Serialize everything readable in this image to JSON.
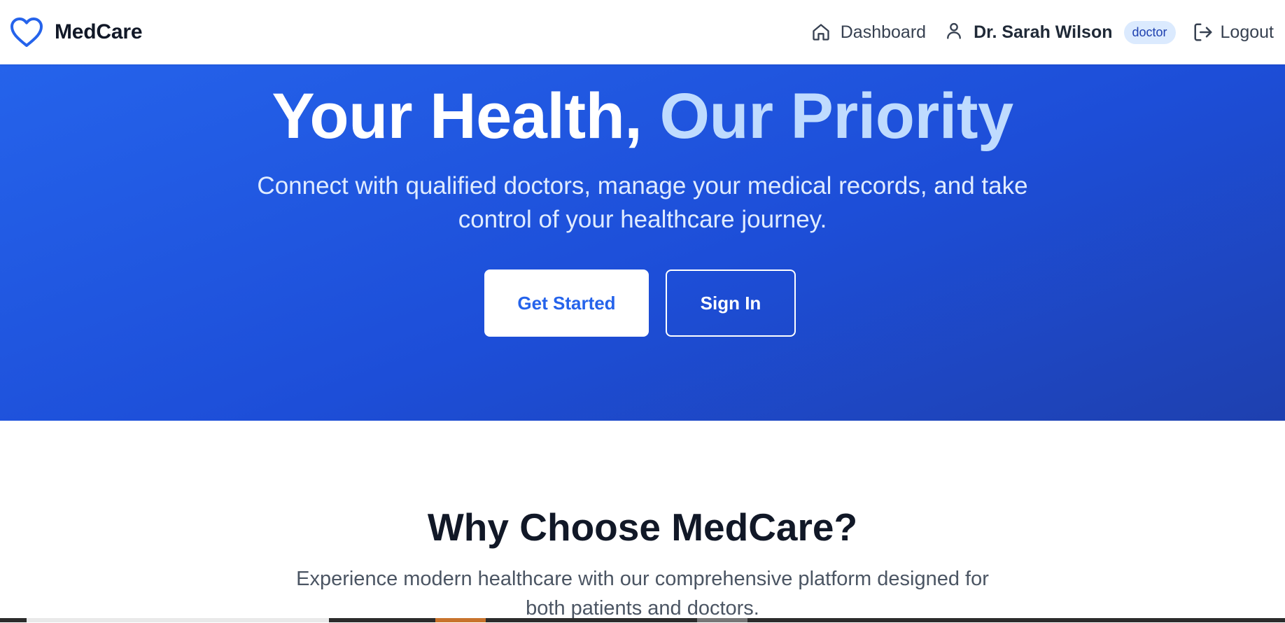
{
  "app": {
    "brand_name": "MedCare",
    "brand_icon": "heart-icon",
    "accent_color": "#2563eb"
  },
  "nav": {
    "dashboard_label": "Dashboard",
    "dashboard_icon": "home-icon",
    "user_icon": "user-icon",
    "user_name": "Dr. Sarah Wilson",
    "user_role": "doctor",
    "logout_label": "Logout",
    "logout_icon": "logout-icon"
  },
  "hero": {
    "title_part1": "Your Health, ",
    "title_part2": "Our Priority",
    "subtitle": "Connect with qualified doctors, manage your medical records, and take control of your healthcare journey.",
    "primary_button": "Get Started",
    "secondary_button": "Sign In",
    "background_color": "#1d4ed8",
    "title_accent_color": "#bfdbfe"
  },
  "features": {
    "title": "Why Choose MedCare?",
    "subtitle": "Experience modern healthcare with our comprehensive platform designed for both patients and doctors."
  }
}
